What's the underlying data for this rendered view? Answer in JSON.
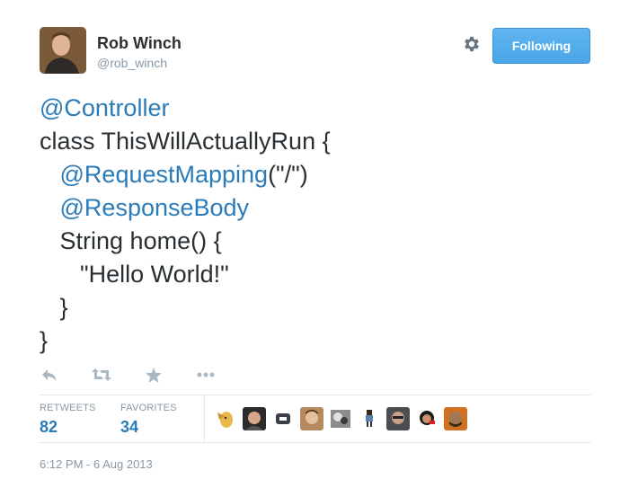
{
  "user": {
    "name": "Rob Winch",
    "handle": "@rob_winch"
  },
  "header": {
    "follow_label": "Following",
    "settings_icon": "gear-icon"
  },
  "tweet": {
    "lines": [
      {
        "mention": "@Controller",
        "rest": ""
      },
      {
        "mention": "",
        "rest": "class ThisWillActuallyRun {"
      },
      {
        "indent": "   ",
        "mention": "@RequestMapping",
        "rest": "(\"/\")"
      },
      {
        "indent": "   ",
        "mention": "@ResponseBody",
        "rest": ""
      },
      {
        "indent": "   ",
        "mention": "",
        "rest": "String home() {"
      },
      {
        "indent": "      ",
        "mention": "",
        "rest": "\"Hello World!\""
      },
      {
        "indent": "   ",
        "mention": "",
        "rest": "}"
      },
      {
        "mention": "",
        "rest": "}"
      }
    ]
  },
  "actions": {
    "icons": [
      "reply-icon",
      "retweet-icon",
      "favorite-icon",
      "more-icon"
    ]
  },
  "stats": {
    "retweets_label": "RETWEETS",
    "retweets_value": "82",
    "favorites_label": "FAVORITES",
    "favorites_value": "34"
  },
  "timestamp": "6:12 PM - 6 Aug 2013",
  "colors": {
    "link": "#2b7bb9",
    "follow_button": "#4ba5e6",
    "muted": "#8899a6",
    "divider": "#e1e8ed"
  }
}
